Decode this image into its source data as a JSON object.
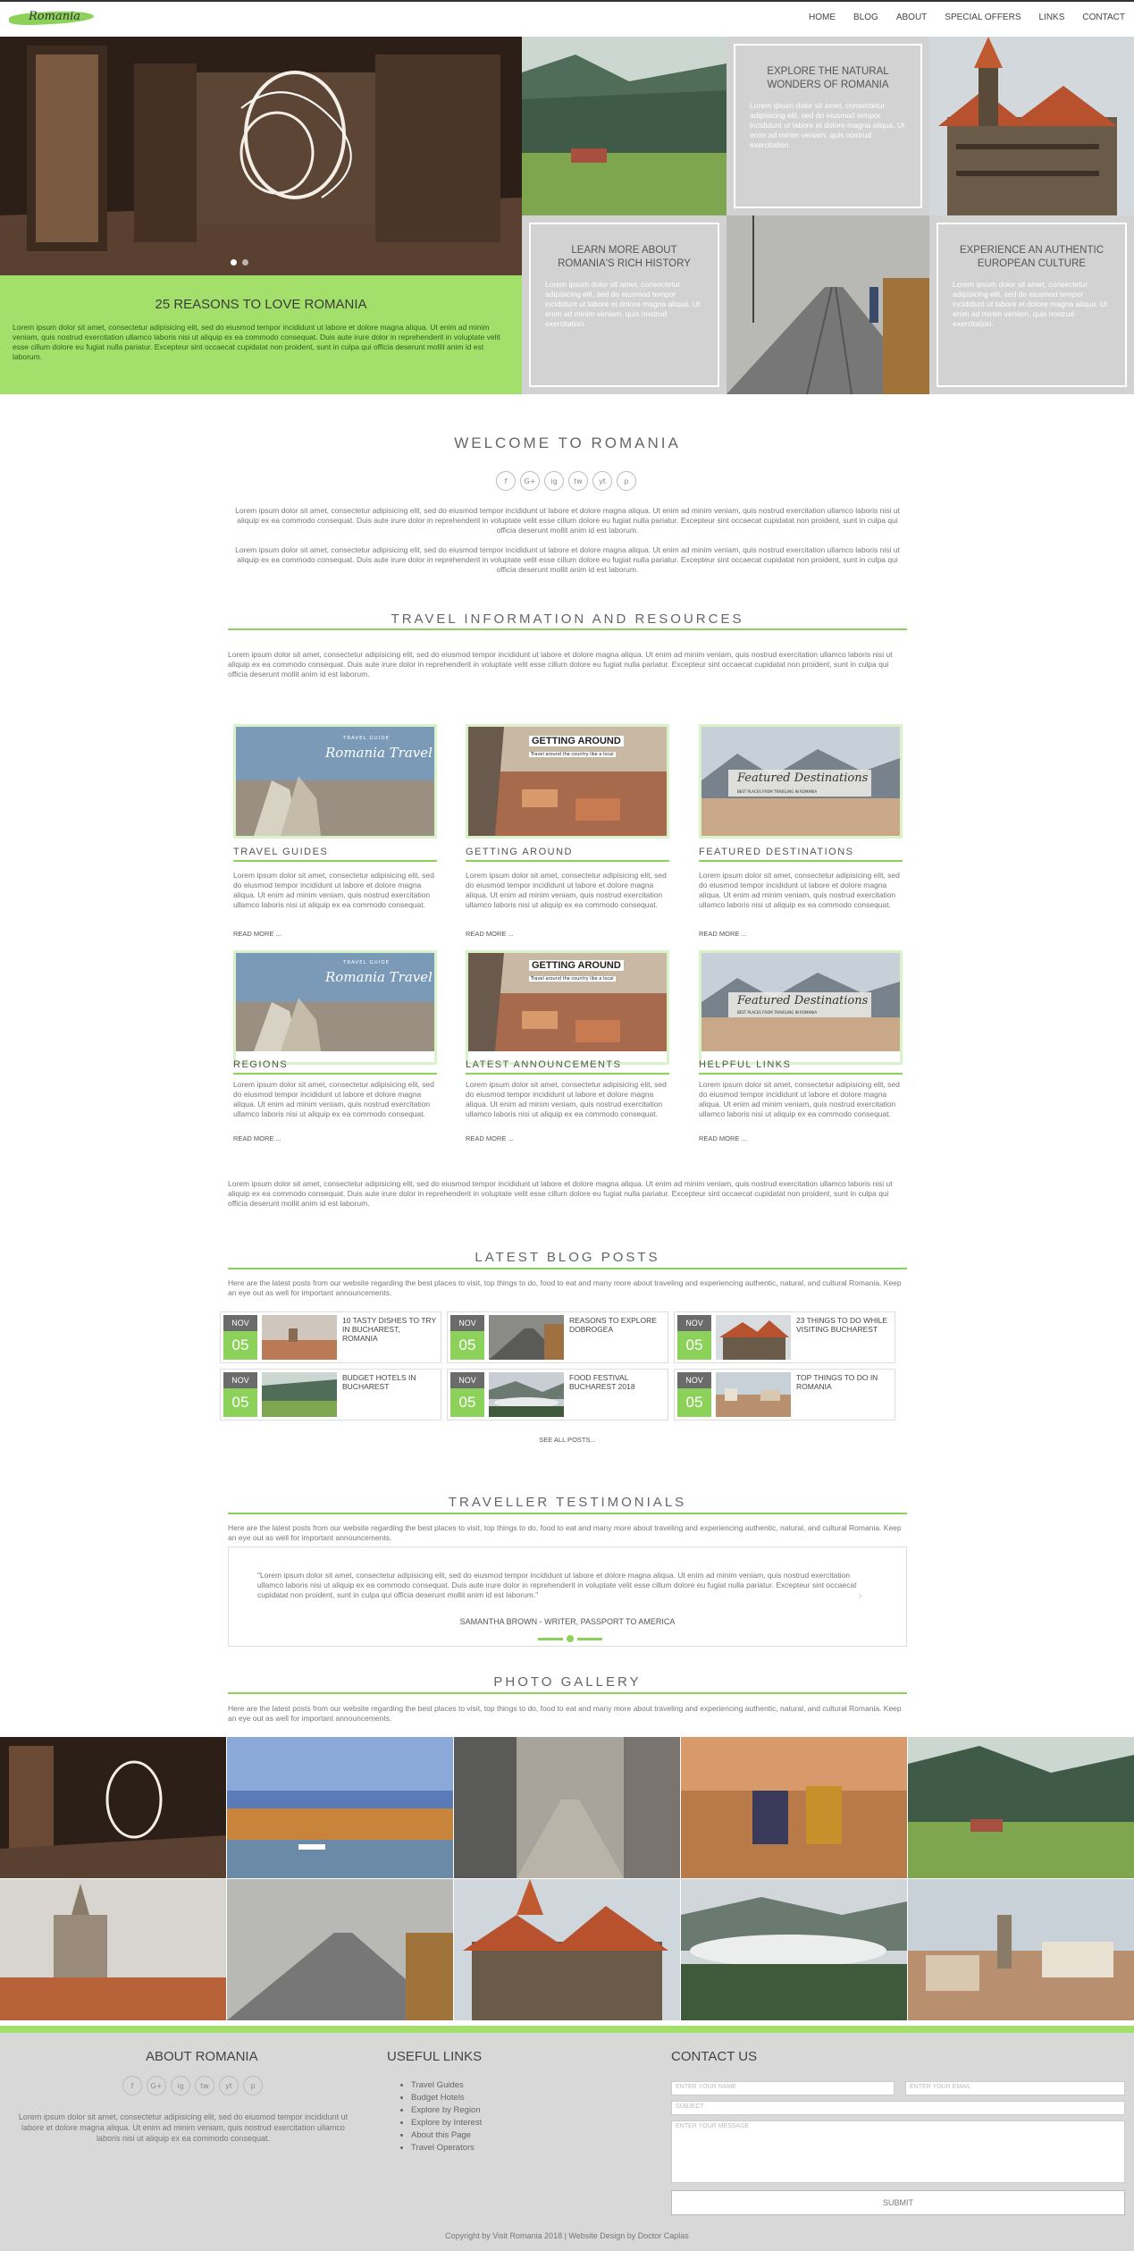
{
  "nav": {
    "logo": "Romania",
    "items": [
      "HOME",
      "BLOG",
      "ABOUT",
      "SPECIAL OFFERS",
      "LINKS",
      "CONTACT"
    ]
  },
  "hero": {
    "slide_title": "25 REASONS TO LOVE ROMANIA",
    "slide_text": "Lorem ipsum dolor sit amet, consectetur adipisicing elit, sed do eiusmod tempor incididunt ut labore et dolore magna aliqua. Ut enim ad minim veniam, quis nostrud exercitation ullamco laboris nisi ut aliquip ex ea commodo consequat. Duis aute irure dolor in reprehenderit in voluptate velit esse cillum dolore eu fugiat nulla pariatur. Excepteur sint occaecat cupidatat non proident, sunt in culpa qui officia deserunt mollit anim id est laborum.",
    "boxes": [
      {
        "title": "EXPLORE THE NATURAL WONDERS OF ROMANIA",
        "text": "Lorem ipsum dolor sit amet, consectetur adipisicing elit, sed do eiusmod tempor incididunt ut labore et dolore magna aliqua. Ut enim ad minim veniam, quis nostrud exercitation."
      },
      {
        "title": "LEARN MORE ABOUT ROMANIA'S RICH HISTORY",
        "text": "Lorem ipsum dolor sit amet, consectetur adipisicing elit, sed do eiusmod tempor incididunt ut labore et dolore magna aliqua. Ut enim ad minim veniam, quis nostrud exercitation."
      },
      {
        "title": "EXPERIENCE AN AUTHENTIC EUROPEAN CULTURE",
        "text": "Lorem ipsum dolor sit amet, consectetur adipisicing elit, sed do eiusmod tempor incididunt ut labore et dolore magna aliqua. Ut enim ad minim veniam, quis nostrud exercitation."
      }
    ]
  },
  "welcome": {
    "title": "WELCOME TO ROMANIA",
    "social": [
      "f",
      "G+",
      "ig",
      "tw",
      "yt",
      "p"
    ],
    "p1": "Lorem ipsum dolor sit amet, consectetur adipisicing elit, sed do eiusmod tempor incididunt ut labore et dolore magna aliqua. Ut enim ad minim veniam, quis nostrud exercitation ullamco laboris nisi ut aliquip ex ea commodo consequat. Duis aute irure dolor in reprehenderit in voluptate velit esse cillum dolore eu fugiat nulla pariatur. Excepteur sint occaecat cupidatat non proident, sunt in culpa qui officia deserunt mollit anim id est laborum.",
    "p2": "Lorem ipsum dolor sit amet, consectetur adipisicing elit, sed do eiusmod tempor incididunt ut labore et dolore magna aliqua. Ut enim ad minim veniam, quis nostrud exercitation ullamco laboris nisi ut aliquip ex ea commodo consequat. Duis aute irure dolor in reprehenderit in voluptate velit esse cillum dolore eu fugiat nulla pariatur. Excepteur sint occaecat cupidatat non proident, sunt in culpa qui officia deserunt mollit anim id est laborum."
  },
  "travel": {
    "title": "TRAVEL INFORMATION AND RESOURCES",
    "intro": "Lorem ipsum dolor sit amet, consectetur adipisicing elit, sed do eiusmod tempor incididunt ut labore et dolore magna aliqua. Ut enim ad minim veniam, quis nostrud exercitation ullamco laboris nisi ut aliquip ex ea commodo consequat. Duis aute irure dolor in reprehenderit in voluptate velit esse cillum dolore eu fugiat nulla pariatur. Excepteur sint occaecat cupidatat non proident, sunt in culpa qui officia deserunt mollit anim id est laborum.",
    "outro": "Lorem ipsum dolor sit amet, consectetur adipisicing elit, sed do eiusmod tempor incididunt ut labore et dolore magna aliqua. Ut enim ad minim veniam, quis nostrud exercitation ullamco laboris nisi ut aliquip ex ea commodo consequat. Duis aute irure dolor in reprehenderit in voluptate velit esse cillum dolore eu fugiat nulla pariatur. Excepteur sint occaecat cupidatat non proident, sunt in culpa qui officia deserunt mollit anim id est laborum.",
    "card_text": "Lorem ipsum dolor sit amet, consectetur adipisicing elit, sed do eiusmod tempor incididunt ut labore et dolore magna aliqua. Ut enim ad minim veniam, quis nostrud exercitation ullamco laboris nisi ut aliquip ex ea commodo consequat.",
    "read_more": "READ MORE ...",
    "banner_guide_small": "TRAVEL GUIDE",
    "banner_guide_big": "Romania Travel",
    "banner_getting_big": "GETTING AROUND",
    "banner_getting_small": "Travel around the country like a local",
    "banner_featured_big": "Featured Destinations",
    "banner_featured_small": "BEST PLACES FROM TRAVELING IN ROMANIA",
    "cards": [
      {
        "title": "TRAVEL GUIDES"
      },
      {
        "title": "GETTING AROUND"
      },
      {
        "title": "FEATURED DESTINATIONS"
      },
      {
        "title": "REGIONS"
      },
      {
        "title": "LATEST ANNOUNCEMENTS"
      },
      {
        "title": "HELPFUL LINKS"
      }
    ]
  },
  "blog": {
    "title": "LATEST BLOG POSTS",
    "intro": "Here are the latest posts from our website regarding the best places to visit, top things to do, food to eat and many more about traveling and experiencing authentic, natural, and cultural Romania. Keep an eye out as well for important announcements.",
    "posts": [
      {
        "month": "NOV",
        "day": "05",
        "title": "10 TASTY DISHES TO TRY IN BUCHAREST, ROMANIA"
      },
      {
        "month": "NOV",
        "day": "05",
        "title": "REASONS TO EXPLORE DOBROGEA"
      },
      {
        "month": "NOV",
        "day": "05",
        "title": "23 THINGS TO DO WHILE VISITING BUCHAREST"
      },
      {
        "month": "NOV",
        "day": "05",
        "title": "BUDGET HOTELS IN BUCHAREST"
      },
      {
        "month": "NOV",
        "day": "05",
        "title": "FOOD FESTIVAL BUCHAREST 2018"
      },
      {
        "month": "NOV",
        "day": "05",
        "title": "TOP THINGS TO DO IN ROMANIA"
      }
    ],
    "see_all": "SEE ALL POSTS..."
  },
  "testimonials": {
    "title": "TRAVELLER TESTIMONIALS",
    "intro": "Here are the latest posts from our website regarding the best places to visit, top things to do, food to eat and many more about traveling and experiencing authentic, natural, and cultural Romania. Keep an eye out as well for important announcements.",
    "quote": "\"Lorem ipsum dolor sit amet, consectetur adipisicing elit, sed do eiusmod tempor incididunt ut labore et dolore magna aliqua. Ut enim ad minim veniam, quis nostrud exercitation ullamco laboris nisi ut aliquip ex ea commodo consequat. Duis aute irure dolor in reprehenderit in voluptate velit esse cillum dolore eu fugiat nulla pariatur. Excepteur sint occaecat cupidatat non proident, sunt in culpa qui officia deserunt mollit anim id est laborum.\"",
    "author": "SAMANTHA BROWN - WRITER, PASSPORT TO AMERICA",
    "next_arrow": "›"
  },
  "gallery": {
    "title": "PHOTO GALLERY",
    "intro": "Here are the latest posts from our website regarding the best places to visit, top things to do, food to eat and many more about traveling and experiencing authentic, natural, and cultural Romania. Keep an eye out as well for important announcements."
  },
  "footer": {
    "about_title": "ABOUT ROMANIA",
    "about_text": "Lorem ipsum dolor sit amet, consectetur adipisicing elit, sed do eiusmod tempor incididunt ut labore et dolore magna aliqua. Ut enim ad minim veniam, quis nostrud exercitation ullamco laboris nisi ut aliquip ex ea commodo consequat.",
    "links_title": "USEFUL LINKS",
    "links": [
      "Travel Guides",
      "Budget Hotels",
      "Explore by Region",
      "Explore by Interest",
      "About this Page",
      "Travel Operators"
    ],
    "contact_title": "CONTACT US",
    "name_ph": "ENTER YOUR NAME",
    "email_ph": "ENTER YOUR EMAIL",
    "subject_ph": "SUBJECT",
    "message_ph": "ENTER YOUR MESSAGE",
    "submit": "SUBMIT",
    "copyright": "Copyright by Visit Romania 2018 | Website Design by Doctor Caplas"
  },
  "colors": {
    "accent": "#8cd15a",
    "accent_light": "#a2e06b",
    "footer_bg": "#d8d8d8",
    "box_bg": "#d2d2d2"
  }
}
